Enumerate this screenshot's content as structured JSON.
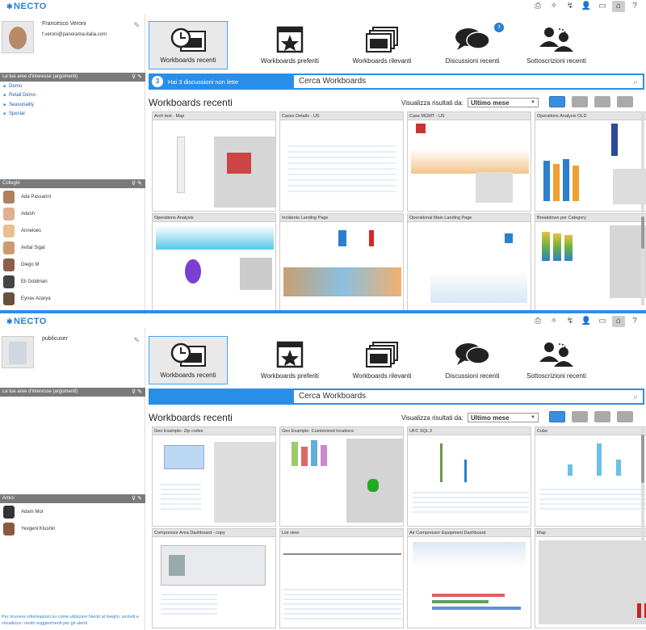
{
  "brand": "NECTO",
  "top1": {
    "user": {
      "name": "Francesco Veroni",
      "email": "f.veroni@panorama-italia.com"
    },
    "interests_header": "Le tue aree d'interesse (argomenti)",
    "topics": [
      "Demo",
      "Retail Demo",
      "Seasonality",
      "Special"
    ],
    "colleagues_header": "Colleghi",
    "colleagues": [
      "Ada Passarini",
      "Adesh",
      "Anneloes",
      "Avital Sigal",
      "Diego M",
      "Eli Goldman",
      "Eynav Azarya"
    ],
    "tabs": [
      "Workboards recenti",
      "Workboards preferiti",
      "Workboards rilevanti",
      "Discussioni recenti",
      "Sottoscrizioni recenti"
    ],
    "discussion_badge": "3",
    "notif_count": "3",
    "notif_text": "Hai 3 discussioni non lette",
    "search_placeholder": "Cerca Workboards",
    "section_title": "Workboards recenti",
    "filter_label": "Visualizza risultati da:",
    "filter_value": "Ultimo mese",
    "cards": [
      "Arch test - Map",
      "Cases Details - US",
      "Case MGMT - US",
      "Operations Analysis OLD",
      "Operations Analysis",
      "Incidents Landing Page",
      "Operational Main Landing Page",
      "Breakdown per Category"
    ]
  },
  "top2": {
    "user": {
      "name": "publicuser"
    },
    "interests_header": "Le tue aree d'interesse (argomenti)",
    "friends_header": "Amici",
    "friends": [
      "Adam Mor",
      "Yevgeni Klushin"
    ],
    "footer": "Per ricevere informazioni su come utilizzare Necto al meglio, iscriviti e visualizza i nostri suggerimenti per gli utenti",
    "tabs": [
      "Workboards recenti",
      "Workboards preferiti",
      "Workboards rilevanti",
      "Discussioni recenti",
      "Sottoscrizioni recenti"
    ],
    "search_placeholder": "Cerca Workboards",
    "section_title": "Workboards recenti",
    "filter_label": "Visualizza risultati da:",
    "filter_value": "Ultimo mese",
    "cards": [
      "Geo Example- Zip codes",
      "Geo Example- Customized locations",
      "UFC SQL 2",
      "Cube",
      "Compressor Area Dashboard - copy",
      "List view",
      "Air Compressor Equipment Dashboard",
      "Map"
    ]
  },
  "icons": [
    "print-icon",
    "magic-wand-icon",
    "refresh-icon",
    "user-settings-icon",
    "screen-icon",
    "home-icon",
    "help-icon"
  ],
  "colors": {
    "accent": "#2a8ee8",
    "brand": "#2a7fd0",
    "section_header": "#7a7a7a"
  }
}
